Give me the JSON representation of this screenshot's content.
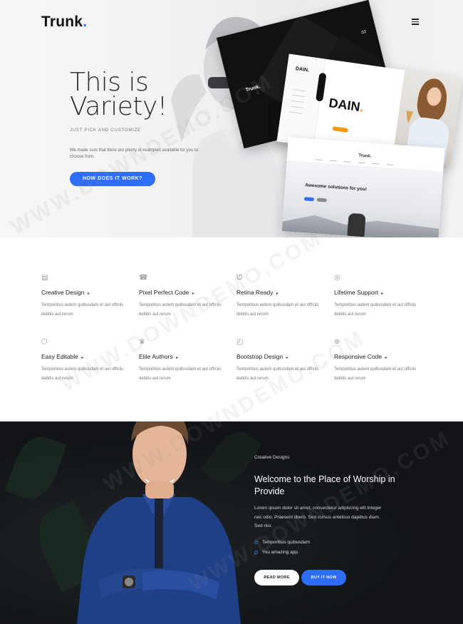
{
  "header": {
    "logo_text": "Trunk",
    "logo_dot": ".",
    "menu_icon": "hamburger-menu-icon"
  },
  "hero": {
    "title_line1": "This is",
    "title_line2": "Variety!",
    "subtitle": "JUST PICK AND CUSTOMIZE",
    "description": "We made sure that there are plenty of examples available for you to choose from.",
    "button_label": "HOW DOES IT WORK?",
    "mockups": {
      "dark_brand": "Trunk.",
      "dark_number": "02",
      "dain_brand": "DAIN.",
      "dain_title": "DAIN",
      "dain_dot": ".",
      "trunk_logo": "Trunk.",
      "trunk_heading": "Awesome solutions for you!"
    }
  },
  "features": [
    {
      "icon": "document-icon",
      "icon_glyph": "▤",
      "title": "Creative Design",
      "arrow": "▸",
      "desc": "Temporibus autem quibusdam et aut officiis debitis aut rerum"
    },
    {
      "icon": "keyboard-icon",
      "icon_glyph": "☎",
      "title": "Pixel Perfect Code",
      "arrow": "▸",
      "desc": "Temporibus autem quibusdam et aut officiis debitis aut rerum"
    },
    {
      "icon": "magnet-icon",
      "icon_glyph": "ᘎ",
      "title": "Retina Ready",
      "arrow": "▸",
      "desc": "Temporibus autem quibusdam et aut officiis debitis aut rerum"
    },
    {
      "icon": "lifebuoy-icon",
      "icon_glyph": "◎",
      "title": "Lifetime Support",
      "arrow": "▸",
      "desc": "Temporibus autem quibusdam et aut officiis debitis aut rerum"
    },
    {
      "icon": "css3-icon",
      "icon_glyph": "⬡",
      "title": "Easy Editable",
      "arrow": "▸",
      "desc": "Temporibus autem quibusdam et aut officiis debitis aut rerum"
    },
    {
      "icon": "crown-icon",
      "icon_glyph": "♛",
      "title": "Elite Authors",
      "arrow": "▸",
      "desc": "Temporibus autem quibusdam et aut officiis debitis aut rerum"
    },
    {
      "icon": "bootstrap-icon",
      "icon_glyph": "◰",
      "title": "Bootstrap Design",
      "arrow": "▸",
      "desc": "Temporibus autem quibusdam et aut officiis debitis aut rerum"
    },
    {
      "icon": "globe-icon",
      "icon_glyph": "⊕",
      "title": "Responsive Code",
      "arrow": "▸",
      "desc": "Temporibus autem quibusdam et aut officiis debitis aut rerum"
    }
  ],
  "about": {
    "label": "Creative Designs",
    "heading": "Welcome to the Place of Worship in Provide",
    "paragraph": "Lorem ipsum dolor sit amet, consectetur adipiscing elit.Integer nec odio. Praesent libero. Sed cursus antelous dapibus diam. Sed nisi.",
    "bullets": [
      "Temporibus quibusdam",
      "You amazing app."
    ],
    "read_more": "READ MORE",
    "buy_it_now": "BUY IT NOW"
  },
  "watermark": "WWW.DOWNDEMO.COM",
  "colors": {
    "accent": "#2e6df6",
    "dark_bg": "#121417"
  }
}
